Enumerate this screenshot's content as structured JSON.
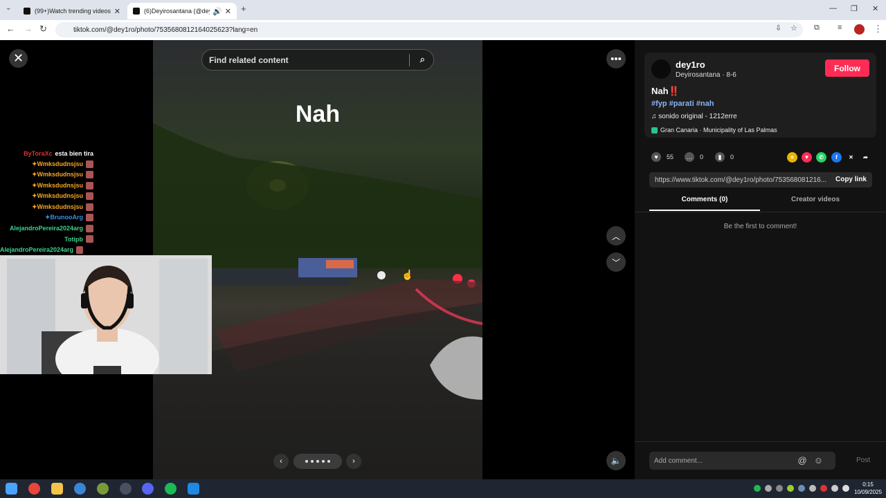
{
  "browser": {
    "tabs": [
      {
        "title": "(99+)Watch trending videos fo",
        "active": false
      },
      {
        "title": "(6)Deyirosantana (@dey1ro",
        "active": true
      }
    ],
    "url": "tiktok.com/@dey1ro/photo/7535680812164025623?lang=en"
  },
  "viewer": {
    "search_placeholder": "Find related content",
    "overlay_text": "Nah"
  },
  "chat": [
    {
      "user": "ByToraXc",
      "msg": "esta bien tira",
      "color": "#e03030"
    },
    {
      "user": "✦Wmksdudnsjsu",
      "msg": "",
      "color": "#f5a623"
    },
    {
      "user": "✦Wmksdudnsjsu",
      "msg": "",
      "color": "#f5a623"
    },
    {
      "user": "✦Wmksdudnsjsu",
      "msg": "",
      "color": "#f5a623"
    },
    {
      "user": "✦Wmksdudnsjsu",
      "msg": "",
      "color": "#f5a623"
    },
    {
      "user": "✦Wmksdudnsjsu",
      "msg": "",
      "color": "#f5a623"
    },
    {
      "user": "✦BrunooArg",
      "msg": "",
      "color": "#3a8ee6"
    },
    {
      "user": "AlejandroPereira2024arg",
      "msg": "",
      "color": "#3fd18f"
    },
    {
      "user": "Totipb",
      "msg": "",
      "color": "#3fd18f"
    },
    {
      "user": "AlejandroPereira2024arg",
      "msg": "",
      "color": "#3fd18f"
    }
  ],
  "post": {
    "username": "dey1ro",
    "subline": "Deyirosantana · 8-6",
    "follow_label": "Follow",
    "caption": "Nah‼️",
    "hashtags": "#fyp #parati #nah",
    "music": "sonido original - 1212erre",
    "location": "Gran Canaria · Municipality of Las Palmas",
    "likes": "55",
    "comments": "0",
    "saves": "0",
    "link": "https://www.tiktok.com/@dey1ro/photo/753568081216...",
    "copy_label": "Copy link",
    "tab_comments": "Comments (0)",
    "tab_creator": "Creator videos",
    "empty_text": "Be the first to comment!",
    "comment_placeholder": "Add comment...",
    "post_label": "Post"
  },
  "taskbar": {
    "time": "0:15",
    "date": "10/09/2025"
  }
}
